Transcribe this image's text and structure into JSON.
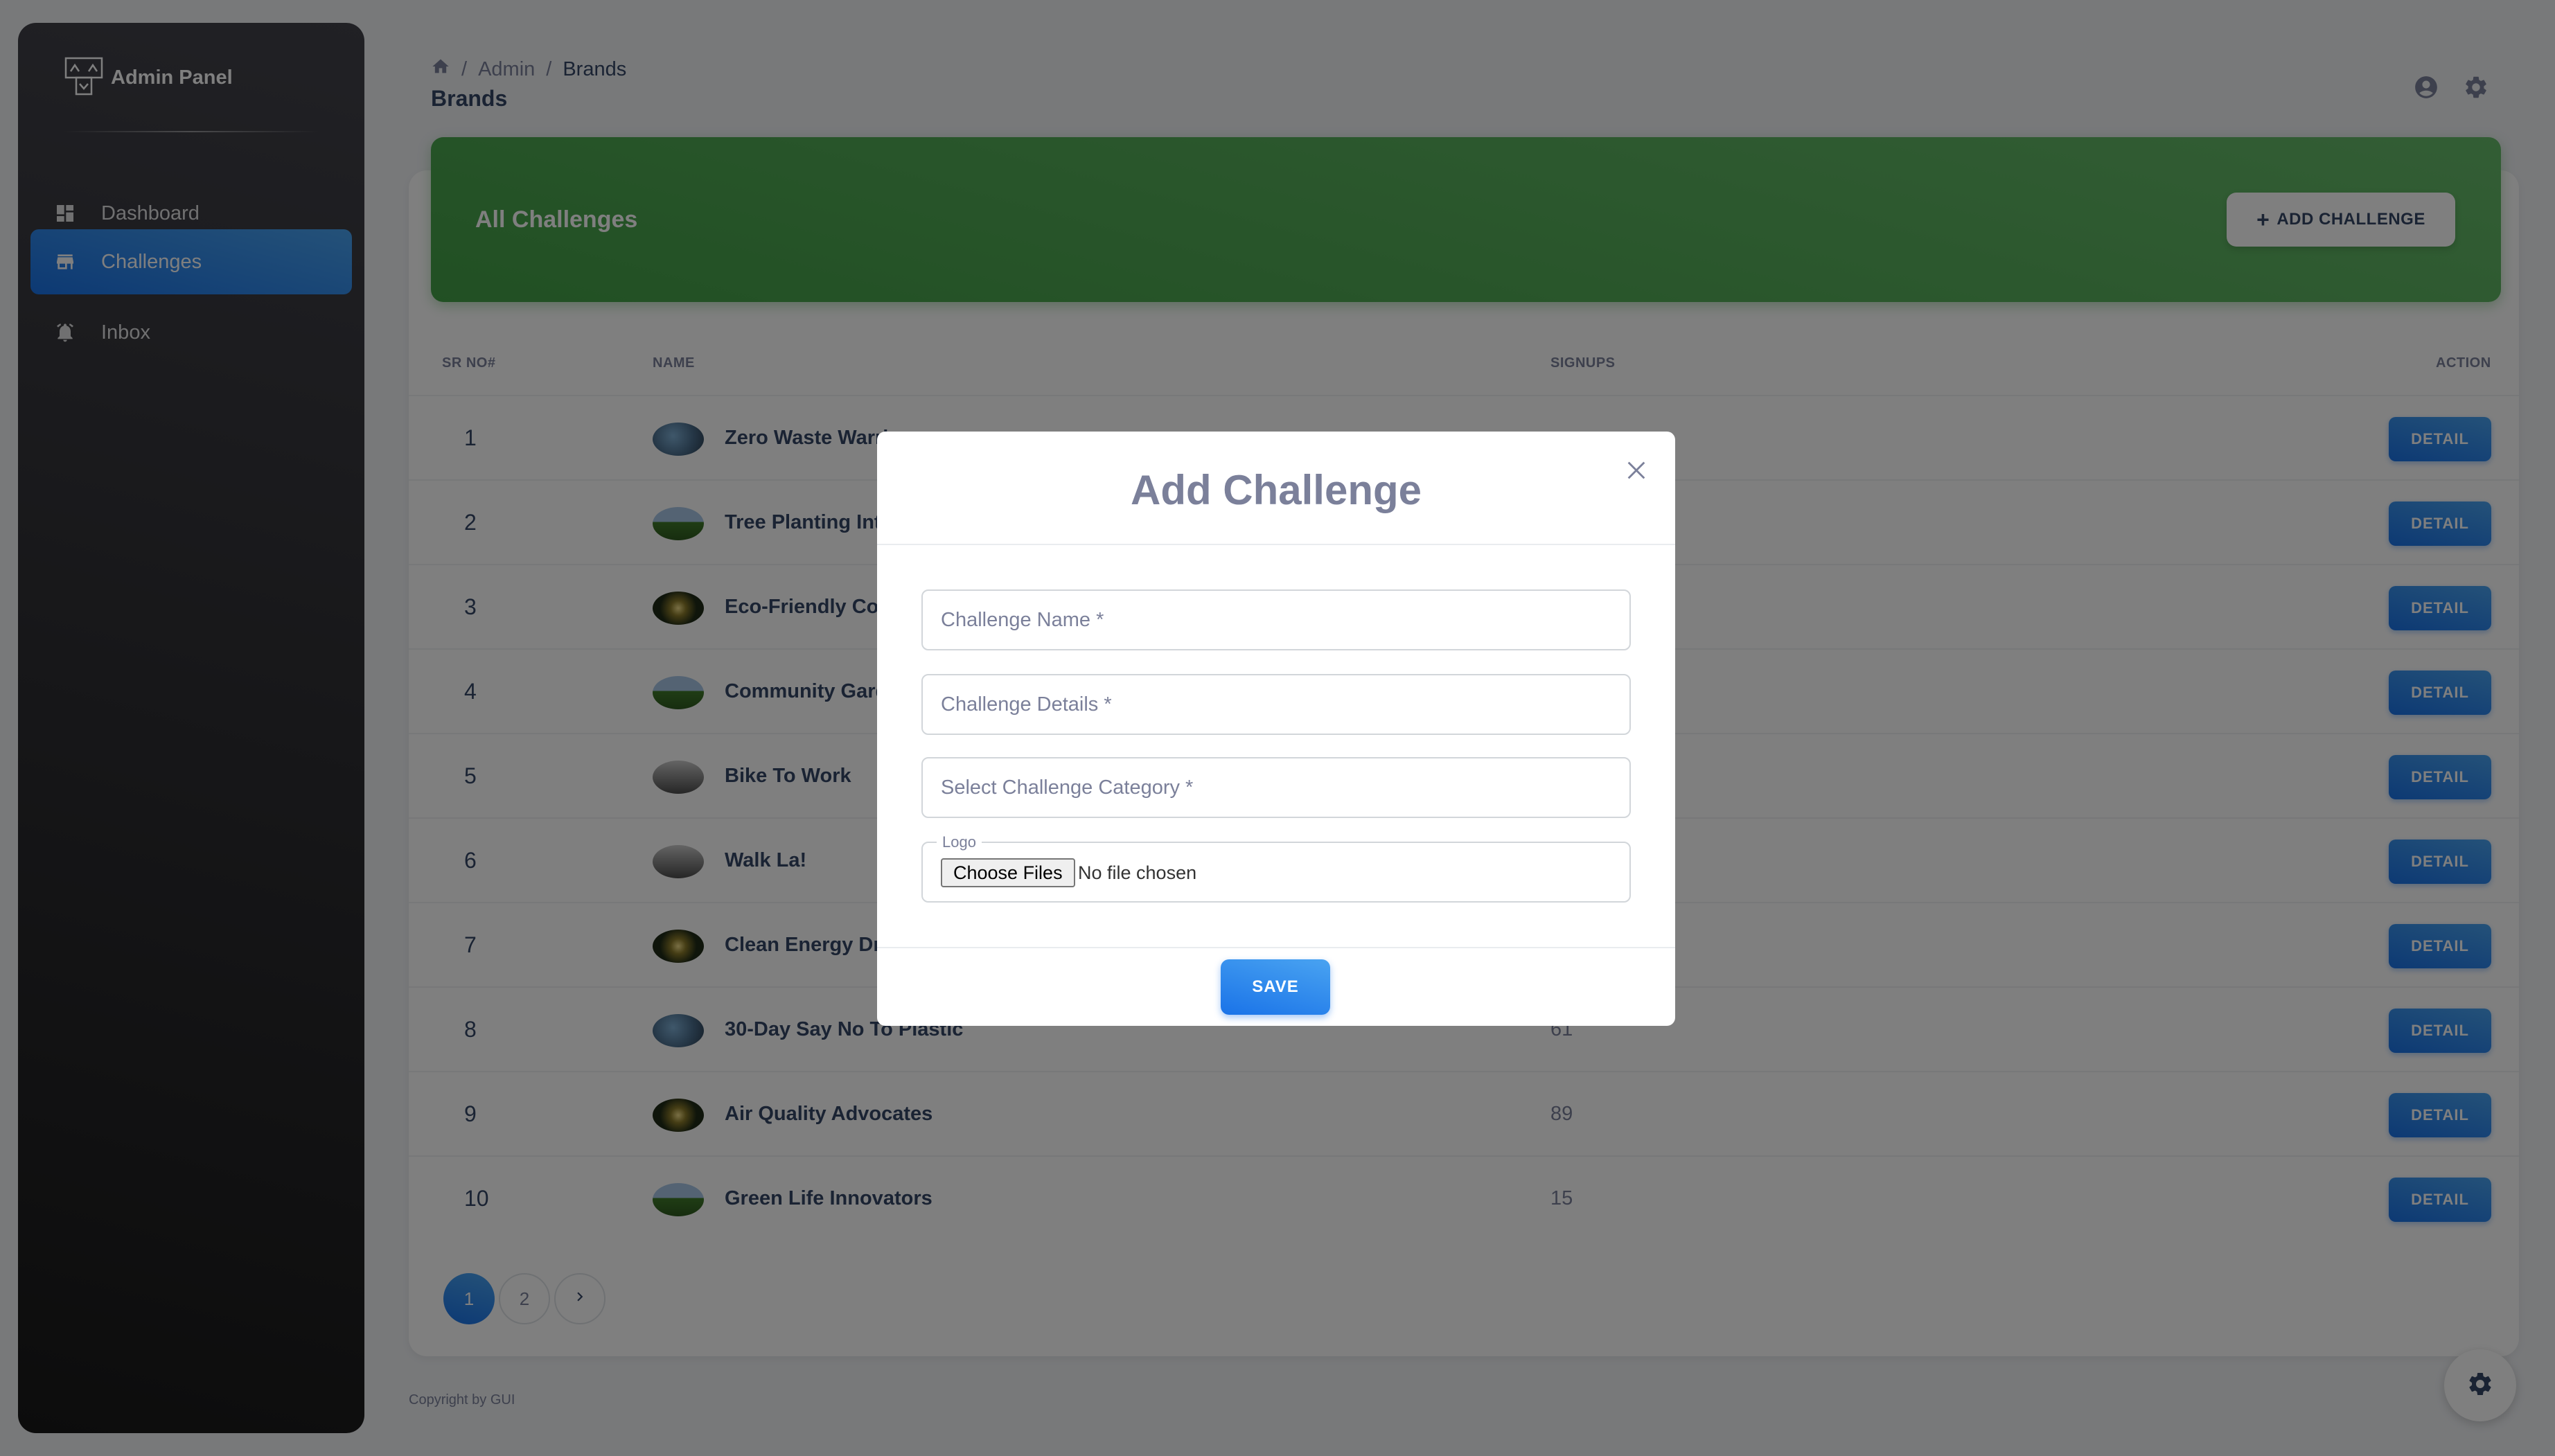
{
  "sidebar": {
    "brand": "Admin Panel",
    "items": [
      {
        "label": "Dashboard",
        "icon": "dashboard-icon"
      },
      {
        "label": "Challenges",
        "icon": "store-icon",
        "active": true
      },
      {
        "label": "Inbox",
        "icon": "bell-icon"
      }
    ]
  },
  "header": {
    "breadcrumb": [
      "Admin",
      "Brands"
    ],
    "title": "Brands"
  },
  "card": {
    "title": "All Challenges",
    "add_button": "ADD CHALLENGE",
    "columns": [
      "SR NO#",
      "NAME",
      "SIGNUPS",
      "ACTION"
    ],
    "rows": [
      {
        "sr": "1",
        "name": "Zero Waste Warri",
        "signups": "",
        "action": "DETAIL"
      },
      {
        "sr": "2",
        "name": "Tree Planting Int",
        "signups": "",
        "action": "DETAIL"
      },
      {
        "sr": "3",
        "name": "Eco-Friendly Cor",
        "signups": "",
        "action": "DETAIL"
      },
      {
        "sr": "4",
        "name": "Community Gard",
        "signups": "",
        "action": "DETAIL"
      },
      {
        "sr": "5",
        "name": "Bike To Work",
        "signups": "",
        "action": "DETAIL"
      },
      {
        "sr": "6",
        "name": "Walk La!",
        "signups": "",
        "action": "DETAIL"
      },
      {
        "sr": "7",
        "name": "Clean Energy Dri",
        "signups": "",
        "action": "DETAIL"
      },
      {
        "sr": "8",
        "name": "30-Day Say No To Plastic",
        "signups": "61",
        "action": "DETAIL"
      },
      {
        "sr": "9",
        "name": "Air Quality Advocates",
        "signups": "89",
        "action": "DETAIL"
      },
      {
        "sr": "10",
        "name": "Green Life Innovators",
        "signups": "15",
        "action": "DETAIL"
      }
    ],
    "pagination": [
      "1",
      "2",
      "›"
    ]
  },
  "footer": {
    "copyright": "Copyright by GUI"
  },
  "modal": {
    "title": "Add Challenge",
    "fields": {
      "name": "Challenge Name *",
      "details": "Challenge Details *",
      "category": "Select Challenge Category *"
    },
    "logo_label": "Logo",
    "choose_files": "Choose Files",
    "no_file": "No file chosen",
    "save": "SAVE"
  },
  "colors": {
    "primary": "#1A73E8",
    "success": "#43A047",
    "sidebar_dark": "#191919"
  }
}
